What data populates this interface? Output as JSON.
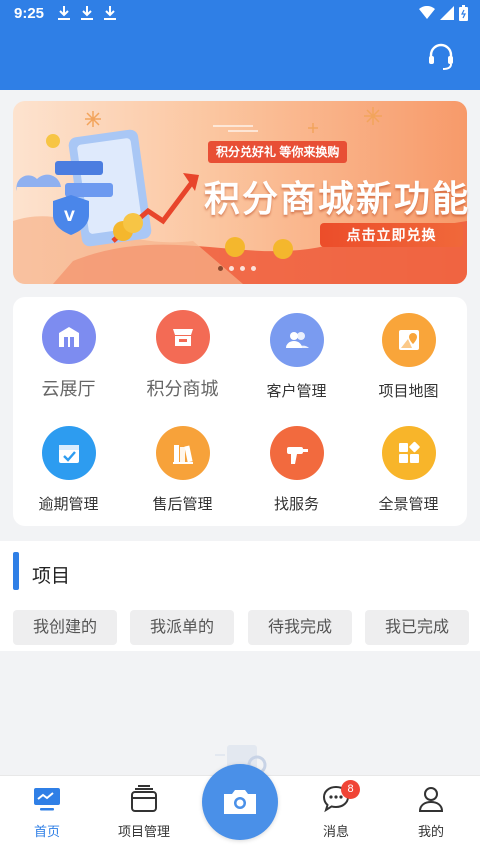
{
  "status_bar": {
    "time": "9:25"
  },
  "banner": {
    "tag": "积分兑好礼 等你来换购",
    "title": "积分商城新功能",
    "cta": "点击立即兑换",
    "page_count": 4,
    "active_page": 1
  },
  "grid": [
    {
      "label": "云展厅",
      "icon": "storefront-icon",
      "color": "#7d8cf0"
    },
    {
      "label": "积分商城",
      "icon": "shop-icon",
      "color": "#f36b55"
    },
    {
      "label": "客户管理",
      "icon": "people-icon",
      "color": "#7a9bf0"
    },
    {
      "label": "项目地图",
      "icon": "map-pin-icon",
      "color": "#f9a53a"
    },
    {
      "label": "逾期管理",
      "icon": "calendar-check-icon",
      "color": "#2d9cf0"
    },
    {
      "label": "售后管理",
      "icon": "books-icon",
      "color": "#f7a23a"
    },
    {
      "label": "找服务",
      "icon": "drill-icon",
      "color": "#f26a3e"
    },
    {
      "label": "全景管理",
      "icon": "panorama-grid-icon",
      "color": "#f8b52a"
    }
  ],
  "section": {
    "title": "项目"
  },
  "filters": [
    "我创建的",
    "我派单的",
    "待我完成",
    "我已完成"
  ],
  "tabs": [
    {
      "label": "首页",
      "icon": "home-monitor-icon"
    },
    {
      "label": "项目管理",
      "icon": "folder-stack-icon"
    },
    {
      "label": "",
      "icon": "camera-icon"
    },
    {
      "label": "消息",
      "icon": "chat-bubble-icon",
      "badge": "8"
    },
    {
      "label": "我的",
      "icon": "user-icon"
    }
  ],
  "colors": {
    "primary": "#2f7fe6",
    "badge": "#f04436"
  }
}
